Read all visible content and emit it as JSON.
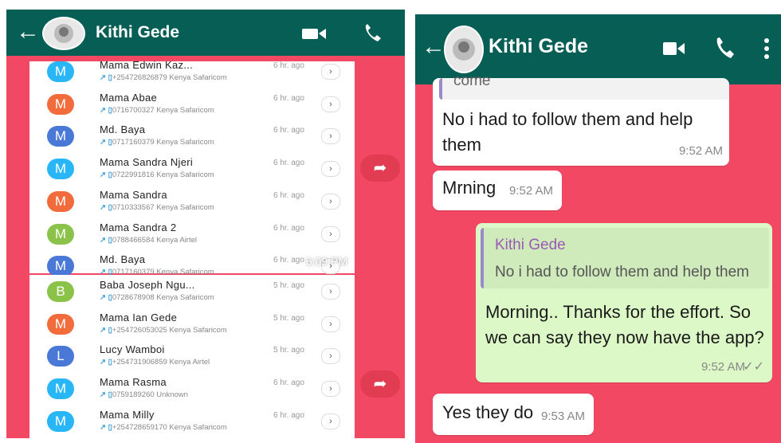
{
  "left": {
    "header": {
      "back_icon": "arrow-left-icon",
      "title": "Kithi Gede",
      "video_icon": "video-call-icon",
      "call_icon": "phone-icon"
    },
    "timestamp": "6:09 PM",
    "card1": [
      {
        "letter": "M",
        "color": "#29b6f6",
        "name": "Mama Edwin Kaz...",
        "number": "+254726826879 Kenya Safaricom",
        "ago": "6 hr. ago"
      },
      {
        "letter": "M",
        "color": "#f26b3a",
        "name": "Mama Abae",
        "number": "0716700327 Kenya Safaricom",
        "ago": "6 hr. ago"
      },
      {
        "letter": "M",
        "color": "#4a78d6",
        "name": "Md. Baya",
        "number": "0717160379 Kenya Safaricom",
        "ago": "6 hr. ago"
      },
      {
        "letter": "M",
        "color": "#29b6f6",
        "name": "Mama Sandra Njeri",
        "number": "0722991816 Kenya Safaricom",
        "ago": "6 hr. ago"
      },
      {
        "letter": "M",
        "color": "#f26b3a",
        "name": "Mama Sandra",
        "number": "0710333567 Kenya Safaricom",
        "ago": "6 hr. ago"
      },
      {
        "letter": "M",
        "color": "#8bc34a",
        "name": "Mama Sandra 2",
        "number": "0788466584 Kenya Airtel",
        "ago": "6 hr. ago"
      },
      {
        "letter": "M",
        "color": "#4a78d6",
        "name": "Md. Baya",
        "number": "0717160379 Kenya Safaricom",
        "ago": "6 hr. ago"
      }
    ],
    "card2": [
      {
        "letter": "B",
        "color": "#8bc34a",
        "name": "Baba Joseph Ngu...",
        "number": "0728678908 Kenya Safaricom",
        "ago": "5 hr. ago"
      },
      {
        "letter": "M",
        "color": "#f26b3a",
        "name": "Mama Ian Gede",
        "number": "+254726053025 Kenya Safaricom",
        "ago": "5 hr. ago"
      },
      {
        "letter": "L",
        "color": "#4a78d6",
        "name": "Lucy Wamboi",
        "number": "+254731906859 Kenya Airtel",
        "ago": "5 hr. ago"
      },
      {
        "letter": "M",
        "color": "#29b6f6",
        "name": "Mama Rasma",
        "number": "0759189260 Unknown",
        "ago": "6 hr. ago"
      },
      {
        "letter": "M",
        "color": "#29b6f6",
        "name": "Mama Milly",
        "number": "+254728659170 Kenya Safaricom",
        "ago": "6 hr. ago"
      }
    ]
  },
  "right": {
    "header": {
      "back_icon": "arrow-left-icon",
      "title": "Kithi Gede",
      "video_icon": "video-call-icon",
      "call_icon": "phone-icon",
      "menu_icon": "more-vertical-icon"
    },
    "messages": {
      "m0_partial": "come",
      "m1_line1": "No i had to follow them and help",
      "m1_line2": "them",
      "m1_time": "9:52 AM",
      "m2_text": "Mrning",
      "m2_time": "9:52 AM",
      "m3_quote_author": "Kithi Gede",
      "m3_quote_text": "No i had to follow them and help them",
      "m3_line1": "Morning.. Thanks for the effort. So",
      "m3_line2": "we can say they now have the app?",
      "m3_time": "9:52 AM",
      "m4_text": "Yes they do",
      "m4_time": "9:53 AM"
    }
  }
}
